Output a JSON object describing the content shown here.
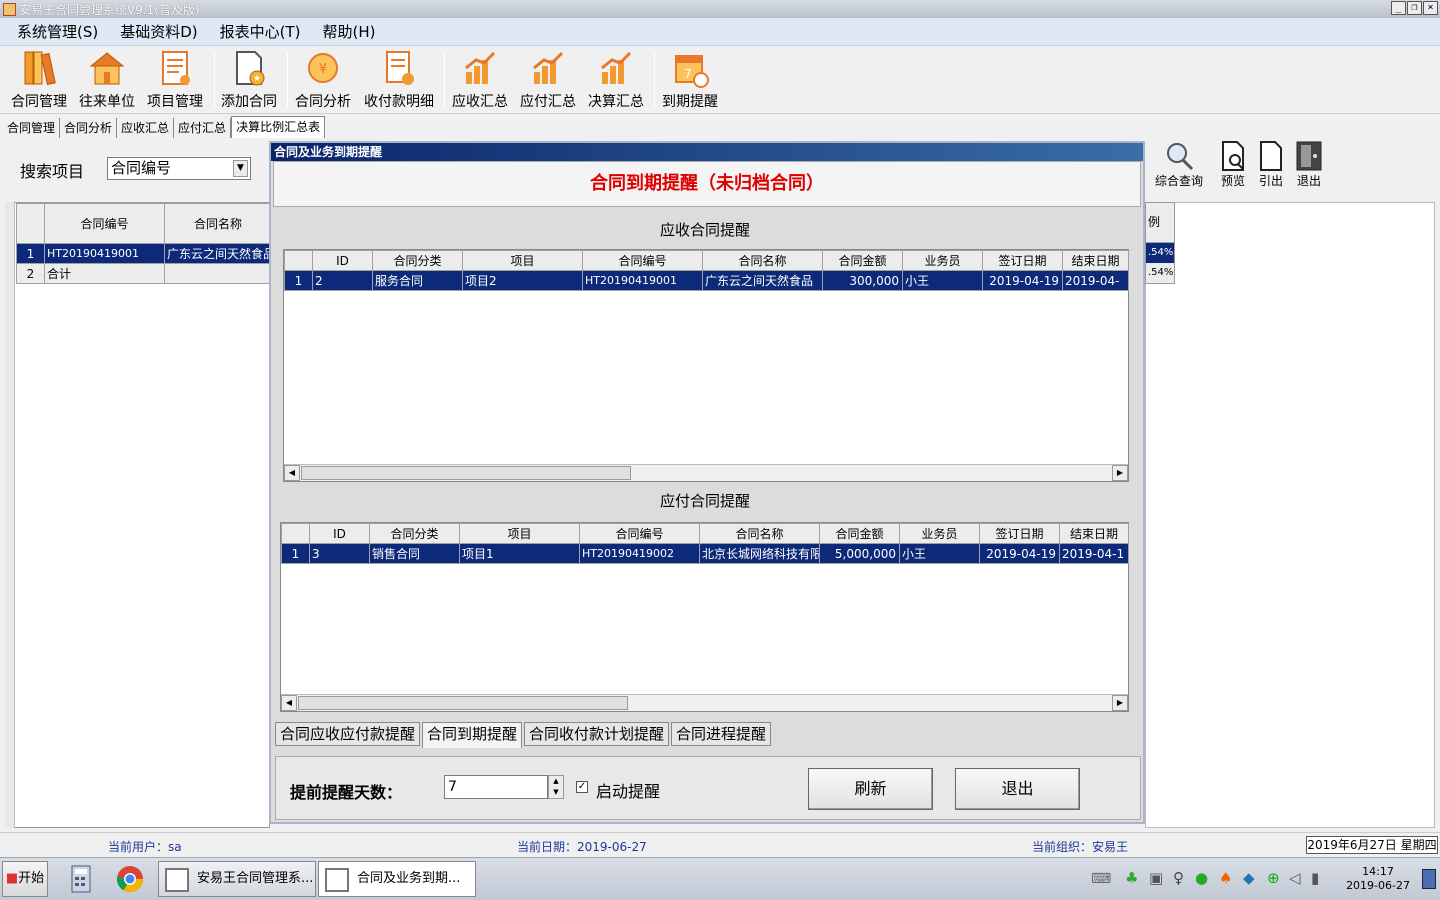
{
  "window": {
    "title": "安易王合同管理系统V9.1(普及版)"
  },
  "menu": [
    {
      "label": "系统管理(S)"
    },
    {
      "label": "基础资料D)"
    },
    {
      "label": "报表中心(T)"
    },
    {
      "label": "帮助(H)"
    }
  ],
  "toolbar": [
    {
      "label": "合同管理",
      "icon": "books-icon"
    },
    {
      "label": "往来单位",
      "icon": "house-icon"
    },
    {
      "label": "项目管理",
      "icon": "clipboard-icon"
    },
    {
      "label": "添加合同",
      "icon": "add-contract-icon"
    },
    {
      "label": "合同分析",
      "icon": "coin-chart-icon"
    },
    {
      "label": "收付款明细",
      "icon": "ledger-check-icon"
    },
    {
      "label": "应收汇总",
      "icon": "bar-chart-icon"
    },
    {
      "label": "应付汇总",
      "icon": "bar-chart-icon"
    },
    {
      "label": "决算汇总",
      "icon": "bar-chart-icon"
    },
    {
      "label": "到期提醒",
      "icon": "calendar-clock-icon"
    }
  ],
  "tabs": [
    {
      "label": "合同管理"
    },
    {
      "label": "合同分析"
    },
    {
      "label": "应收汇总"
    },
    {
      "label": "应付汇总"
    },
    {
      "label": "决算比例汇总表"
    }
  ],
  "search": {
    "label": "搜索项目",
    "value": "合同编号"
  },
  "left_grid": {
    "headers": [
      "合同编号",
      "合同名称"
    ],
    "rows": [
      {
        "num": "1",
        "code": "HT20190419001",
        "name": "广东云之间天然食品"
      },
      {
        "num": "2",
        "code": "合计",
        "name": ""
      }
    ]
  },
  "right_tools": [
    {
      "label": "综合查询"
    },
    {
      "label": "预览"
    },
    {
      "label": "引出"
    },
    {
      "label": "退出"
    }
  ],
  "right_grid": {
    "header": "例",
    "rows": [
      ".54%",
      ".54%"
    ]
  },
  "dialog": {
    "title": "合同及业务到期提醒",
    "heading": "合同到期提醒（未归档合同）",
    "receivable": {
      "section": "应收合同提醒",
      "headers": [
        "ID",
        "合同分类",
        "项目",
        "合同编号",
        "合同名称",
        "合同金额",
        "业务员",
        "签订日期",
        "结束日期"
      ],
      "rows": [
        {
          "num": "1",
          "id": "2",
          "category": "服务合同",
          "project": "项目2",
          "code": "HT20190419001",
          "name": "广东云之间天然食品",
          "amount": "300,000",
          "salesman": "小王",
          "sign_date": "2019-04-19",
          "end_date": "2019-04-"
        }
      ]
    },
    "payable": {
      "section": "应付合同提醒",
      "headers": [
        "ID",
        "合同分类",
        "项目",
        "合同编号",
        "合同名称",
        "合同金额",
        "业务员",
        "签订日期",
        "结束日期"
      ],
      "rows": [
        {
          "num": "1",
          "id": "3",
          "category": "销售合同",
          "project": "项目1",
          "code": "HT20190419002",
          "name": "北京长城网络科技有限",
          "amount": "5,000,000",
          "salesman": "小王",
          "sign_date": "2019-04-19",
          "end_date": "2019-04-1"
        }
      ]
    },
    "bottom_tabs": [
      {
        "label": "合同应收应付款提醒"
      },
      {
        "label": "合同到期提醒"
      },
      {
        "label": "合同收付款计划提醒"
      },
      {
        "label": "合同进程提醒"
      }
    ],
    "advance_label": "提前提醒天数：",
    "advance_value": "7",
    "enable_label": "启动提醒",
    "refresh_label": "刷新",
    "exit_label": "退出"
  },
  "status": {
    "user": "当前用户：sa",
    "date": "当前日期：2019-06-27",
    "org": "当前组织：安易王",
    "datebox": "2019年6月27日 星期四"
  },
  "taskbar": {
    "start": "开始",
    "tasks": [
      {
        "label": "安易王合同管理系..."
      },
      {
        "label": "合同及业务到期..."
      }
    ],
    "time": "14:17",
    "date": "2019-06-27"
  }
}
